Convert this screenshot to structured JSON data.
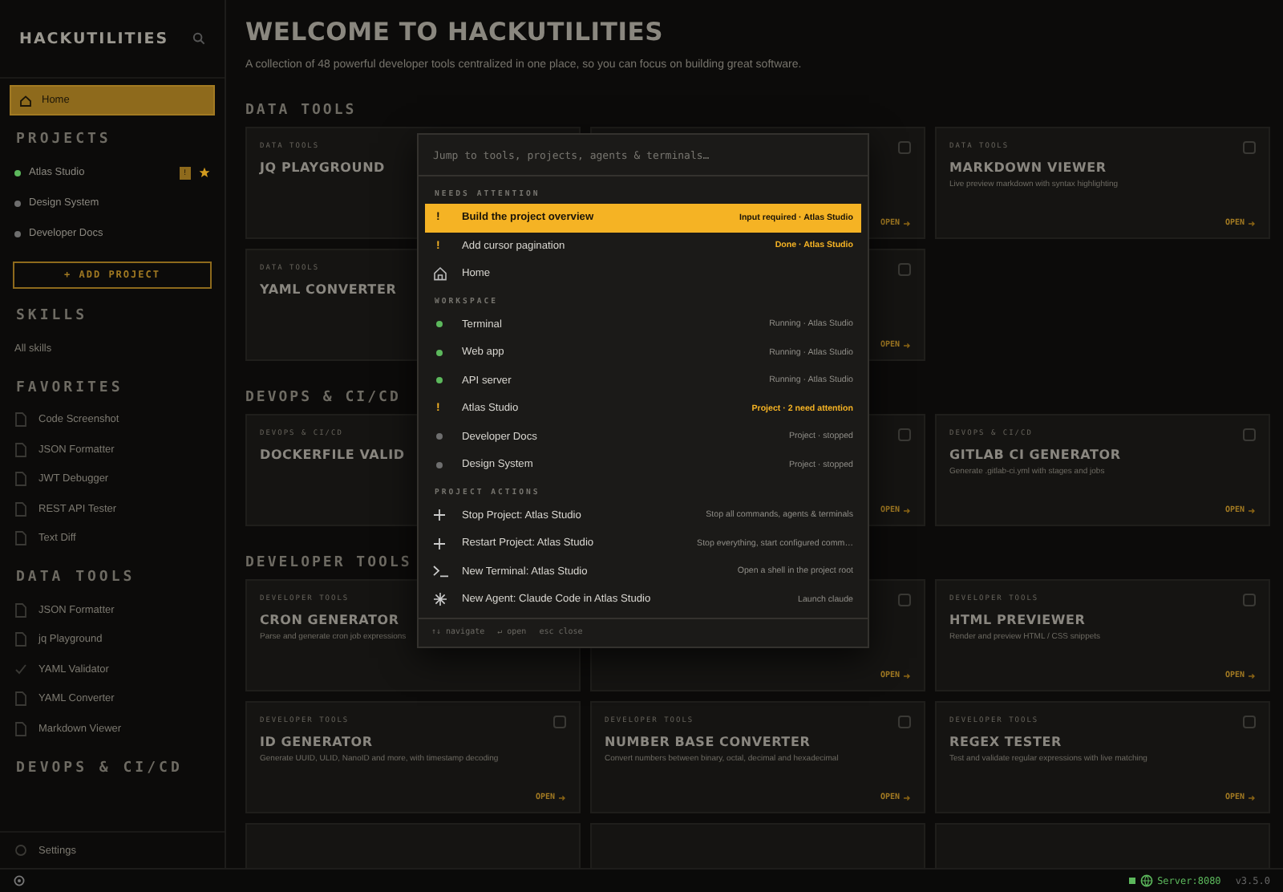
{
  "sidebar": {
    "logo": "HACKUTILITIES",
    "nav": [
      {
        "label": "Home",
        "selected": true
      }
    ],
    "projects": {
      "title": "PROJECTS",
      "items": [
        {
          "name": "Atlas Studio",
          "color": "#5cb85c",
          "badge": "!",
          "starred": true
        },
        {
          "name": "Design System",
          "color": "#6e6e6e",
          "starred": false
        },
        {
          "name": "Developer Docs",
          "color": "#6e6e6e",
          "starred": false
        }
      ],
      "add_label": "+ ADD PROJECT"
    },
    "groups": [
      {
        "title": "SKILLS",
        "items": [
          {
            "label": "All skills",
            "kind": "link"
          }
        ]
      },
      {
        "title": "FAVORITES",
        "items": [
          {
            "label": "Code Screenshot",
            "kind": "tool"
          },
          {
            "label": "JSON Formatter",
            "kind": "tool"
          },
          {
            "label": "JWT Debugger",
            "kind": "tool"
          },
          {
            "label": "REST API Tester",
            "kind": "tool"
          },
          {
            "label": "Text Diff",
            "kind": "tool"
          }
        ]
      },
      {
        "title": "DATA TOOLS",
        "items": [
          {
            "label": "JSON Formatter",
            "kind": "tool"
          },
          {
            "label": "jq Playground",
            "kind": "tool"
          },
          {
            "label": "YAML Validator",
            "kind": "check"
          },
          {
            "label": "YAML Converter",
            "kind": "tool"
          },
          {
            "label": "Markdown Viewer",
            "kind": "tool"
          }
        ]
      },
      {
        "title": "DEVOPS & CI/CD"
      }
    ],
    "footer": {
      "label": "Settings"
    }
  },
  "main": {
    "title": "WELCOME TO HACKUTILITIES",
    "subtitle": "A collection of 48 powerful developer tools centralized in one place, so you can focus on building great software.",
    "sections": [
      {
        "title": "DATA TOOLS",
        "cards": [
          {
            "kind": "tool",
            "category": "DATA TOOLS",
            "title": "JQ PLAYGROUND"
          },
          {
            "kind": "covered",
            "action": "OPEN"
          },
          {
            "kind": "tool",
            "category": "DATA TOOLS",
            "title": "MARKDOWN VIEWER",
            "description": "Live preview markdown with syntax highlighting",
            "action": "OPEN"
          },
          {
            "kind": "tool",
            "category": "DATA TOOLS",
            "title": "YAML CONVERTER"
          },
          {
            "kind": "covered",
            "action": "OPEN"
          }
        ]
      },
      {
        "title": "DEVOPS & CI/CD",
        "cards": [
          {
            "kind": "tool",
            "category": "DEVOPS & CI/CD",
            "title": "DOCKERFILE VALID"
          },
          {
            "kind": "covered",
            "action": "OPEN"
          },
          {
            "kind": "tool",
            "category": "DEVOPS & CI/CD",
            "title": "GITLAB CI GENERATOR",
            "description": "Generate .gitlab-ci.yml with stages and jobs",
            "action": "OPEN"
          }
        ]
      },
      {
        "title": "DEVELOPER TOOLS",
        "cards": [
          {
            "kind": "tool",
            "category": "DEVELOPER TOOLS",
            "title": "CRON GENERATOR",
            "description": "Parse and generate cron job expressions"
          },
          {
            "kind": "covered",
            "action": "OPEN"
          },
          {
            "kind": "tool",
            "category": "DEVELOPER TOOLS",
            "title": "HTML PREVIEWER",
            "description": "Render and preview HTML / CSS snippets",
            "action": "OPEN"
          },
          {
            "kind": "tool",
            "category": "DEVELOPER TOOLS",
            "title": "ID GENERATOR",
            "description": "Generate UUID, ULID, NanoID and more, with timestamp decoding",
            "action": "OPEN"
          },
          {
            "kind": "tool",
            "category": "DEVELOPER TOOLS",
            "title": "NUMBER BASE CONVERTER",
            "description": "Convert numbers between binary, octal, decimal and hexadecimal",
            "action": "OPEN"
          },
          {
            "kind": "tool",
            "category": "DEVELOPER TOOLS",
            "title": "REGEX TESTER",
            "description": "Test and validate regular expressions with live matching",
            "action": "OPEN"
          },
          {
            "kind": "stub"
          },
          {
            "kind": "stub"
          },
          {
            "kind": "stub"
          }
        ]
      }
    ]
  },
  "palette": {
    "placeholder": "Jump to tools, projects, agents & terminals…",
    "groups": [
      {
        "title": "NEEDS ATTENTION",
        "items": [
          {
            "kind": "alert",
            "mark": "!",
            "label": "Build the project overview",
            "meta": "Input required · Atlas Studio",
            "emphasis": true,
            "selected": true
          },
          {
            "kind": "alert",
            "mark": "!",
            "label": "Add cursor pagination",
            "meta": "Done · Atlas Studio",
            "emphasis": true,
            "selected": false
          },
          {
            "kind": "house",
            "label": "Home",
            "selected": false
          }
        ]
      },
      {
        "title": "WORKSPACE",
        "items": [
          {
            "kind": "dot",
            "color": "#5cb85c",
            "label": "Terminal",
            "meta": "Running · Atlas Studio",
            "emphasis": false,
            "selected": false
          },
          {
            "kind": "dot",
            "color": "#5cb85c",
            "label": "Web app",
            "meta": "Running · Atlas Studio",
            "emphasis": false,
            "selected": false
          },
          {
            "kind": "dot",
            "color": "#5cb85c",
            "label": "API server",
            "meta": "Running · Atlas Studio",
            "emphasis": false,
            "selected": false
          },
          {
            "kind": "alert",
            "mark": "!",
            "label": "Atlas Studio",
            "meta": "Project · 2 need attention",
            "emphasis": true,
            "selected": false
          },
          {
            "kind": "dot",
            "color": "#6e6e6e",
            "label": "Developer Docs",
            "meta": "Project · stopped",
            "emphasis": false,
            "selected": false
          },
          {
            "kind": "dot",
            "color": "#6e6e6e",
            "label": "Design System",
            "meta": "Project · stopped",
            "emphasis": false,
            "selected": false
          }
        ]
      },
      {
        "title": "PROJECT ACTIONS",
        "items": [
          {
            "kind": "plus",
            "label": "Stop Project: Atlas Studio",
            "meta": "Stop all commands, agents & terminals",
            "emphasis": false,
            "selected": false
          },
          {
            "kind": "plus",
            "label": "Restart Project: Atlas Studio",
            "meta": "Stop everything, start configured comm…",
            "emphasis": false,
            "selected": false
          },
          {
            "kind": "prompt",
            "label": "New Terminal: Atlas Studio",
            "meta": "Open a shell in the project root",
            "emphasis": false,
            "selected": false
          },
          {
            "kind": "sparkle",
            "label": "New Agent: Claude Code in Atlas Studio",
            "meta": "Launch claude",
            "emphasis": false,
            "selected": false
          }
        ]
      }
    ],
    "hints": [
      "↑↓ navigate",
      "↵ open",
      "esc close"
    ]
  },
  "status_bar": {
    "server": "Server:8080",
    "version": "v3.5.0"
  }
}
